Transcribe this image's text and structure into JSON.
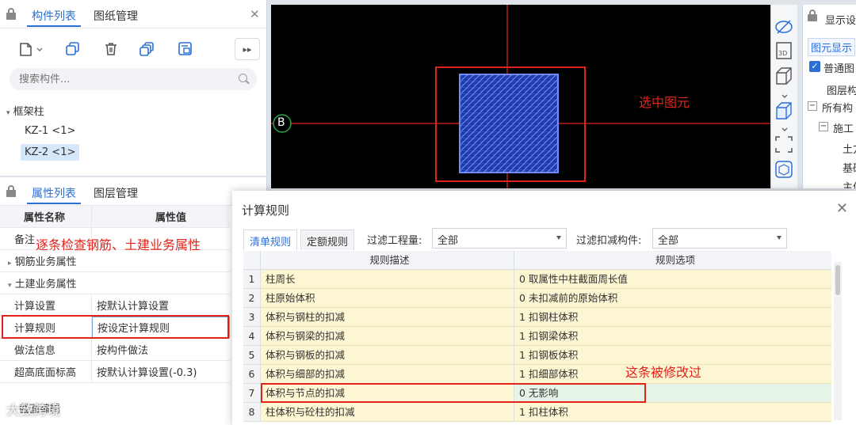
{
  "component_panel": {
    "tab_active": "构件列表",
    "tab_inactive": "图纸管理",
    "search_placeholder": "搜索构件...",
    "tree_group": "框架柱",
    "items": [
      {
        "label": "KZ-1 <1>"
      },
      {
        "label": "KZ-2 <1>"
      }
    ],
    "toolbar_icons": [
      "new-icon",
      "copy-icon",
      "delete-icon",
      "layer-copy-icon",
      "floor-copy-icon",
      "expand-more-icon"
    ]
  },
  "property_panel": {
    "tab_active": "属性列表",
    "tab_inactive": "图层管理",
    "col_name": "属性名称",
    "col_value": "属性值",
    "rows": [
      {
        "name": "备注",
        "value": ""
      },
      {
        "group": "钢筋业务属性"
      },
      {
        "group": "土建业务属性"
      },
      {
        "name": "计算设置",
        "value": "按默认计算设置"
      },
      {
        "name": "计算规则",
        "value": "按设定计算规则"
      },
      {
        "name": "做法信息",
        "value": "按构件做法"
      },
      {
        "name": "超高底面标高",
        "value": "按默认计算设置(-0.3)"
      }
    ],
    "bottom_tab": "截面编辑"
  },
  "viewport": {
    "axis_label": "B",
    "annotation": "选中图元"
  },
  "display_panel": {
    "title": "显示设",
    "tab": "图元显示",
    "checkbox": "普通图",
    "col": "图层构",
    "tree": [
      "所有构",
      "施工",
      "土方",
      "基础",
      "主体"
    ]
  },
  "dialog": {
    "title": "计算规则",
    "tab_active": "清单规则",
    "tab_inactive": "定额规则",
    "filter1_label": "过滤工程量:",
    "filter1_value": "全部",
    "filter2_label": "过滤扣减构件:",
    "filter2_value": "全部",
    "col_desc": "规则描述",
    "col_option": "规则选项",
    "rows": [
      {
        "n": "1",
        "desc": "柱周长",
        "option": "0 取属性中柱截面周长值"
      },
      {
        "n": "2",
        "desc": "柱原始体积",
        "option": "0 未扣减前的原始体积"
      },
      {
        "n": "3",
        "desc": "体积与钢柱的扣减",
        "option": "1 扣钢柱体积"
      },
      {
        "n": "4",
        "desc": "体积与钢梁的扣减",
        "option": "1 扣钢梁体积"
      },
      {
        "n": "5",
        "desc": "体积与钢板的扣减",
        "option": "1 扣钢板体积"
      },
      {
        "n": "6",
        "desc": "体积与细部的扣减",
        "option": "1 扣细部体积"
      },
      {
        "n": "7",
        "desc": "体积与节点的扣减",
        "option": "0  无影响"
      },
      {
        "n": "8",
        "desc": "柱体积与砼柱的扣减",
        "option": "1 扣柱体积"
      }
    ]
  },
  "annotations": {
    "check_properties": "逐条检查钢筋、土建业务属性",
    "modified": "这条被修改过"
  },
  "watermark": "大致跨境",
  "colors": {
    "accent": "#2b6fd6",
    "annotation": "#e2231a",
    "row_fill": "#fdf6d3",
    "modified_fill": "#e6f4e7"
  }
}
